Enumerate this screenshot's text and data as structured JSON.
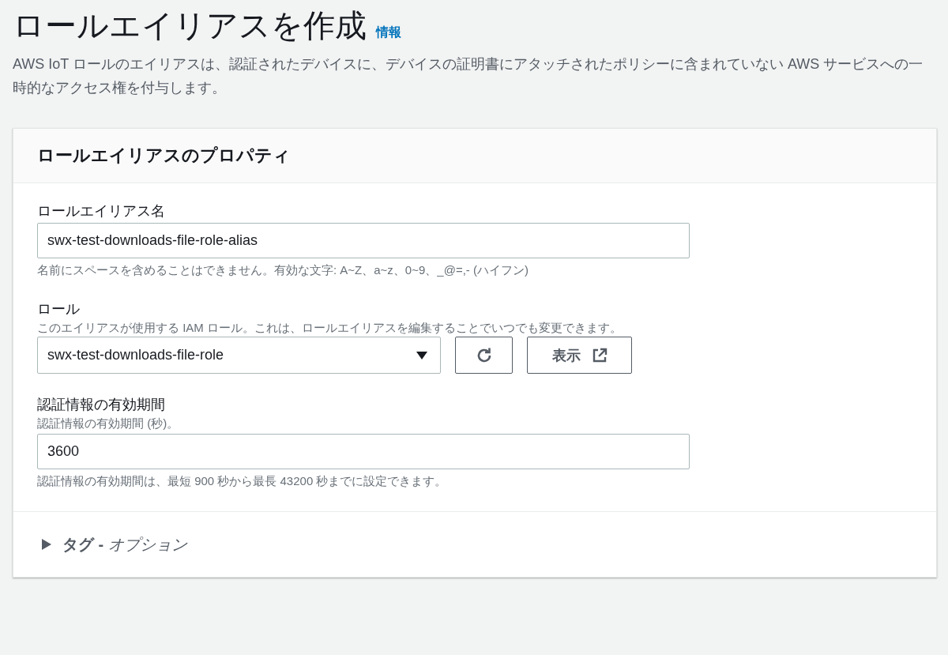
{
  "header": {
    "title": "ロールエイリアスを作成",
    "info_link": "情報",
    "description": "AWS IoT ロールのエイリアスは、認証されたデバイスに、デバイスの証明書にアタッチされたポリシーに含まれていない AWS サービスへの一時的なアクセス権を付与します。"
  },
  "card": {
    "title": "ロールエイリアスのプロパティ",
    "fields": [
      {
        "kind": "text",
        "label": "ロールエイリアス名",
        "value": "swx-test-downloads-file-role-alias",
        "help": "名前にスペースを含めることはできません。有効な文字: A~Z、a~z、0~9、_@=,- (ハイフン)"
      },
      {
        "kind": "select",
        "label": "ロール",
        "description": "このエイリアスが使用する IAM ロール。これは、ロールエイリアスを編集することでいつでも変更できます。",
        "value": "swx-test-downloads-file-role",
        "view_button": "表示"
      },
      {
        "kind": "text",
        "label": "認証情報の有効期間",
        "description": "認証情報の有効期間 (秒)。",
        "value": "3600",
        "help": "認証情報の有効期間は、最短 900 秒から最長 43200 秒までに設定できます。"
      }
    ],
    "tags": {
      "label": "**タグ -** *オプション*",
      "expanded": false
    }
  }
}
